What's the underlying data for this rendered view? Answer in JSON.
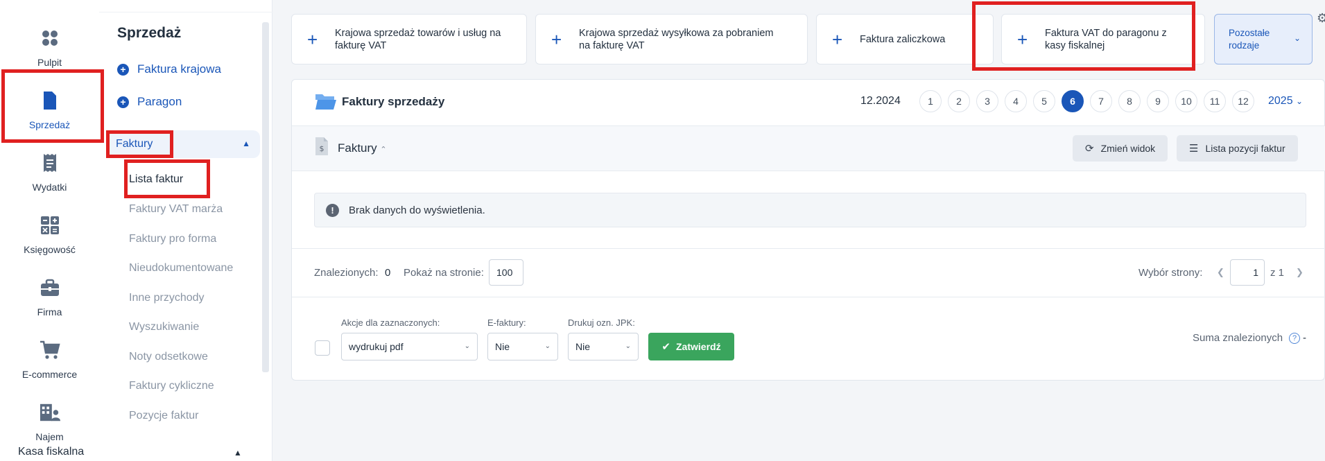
{
  "rail": [
    {
      "label": "Pulpit",
      "icon": "dashboard-icon"
    },
    {
      "label": "Sprzedaż",
      "icon": "invoice-dollar-icon"
    },
    {
      "label": "Wydatki",
      "icon": "receipt-icon"
    },
    {
      "label": "Księgowość",
      "icon": "calculator-icon"
    },
    {
      "label": "Firma",
      "icon": "briefcase-icon"
    },
    {
      "label": "E-commerce",
      "icon": "cart-icon"
    },
    {
      "label": "Najem",
      "icon": "building-person-icon"
    }
  ],
  "sidebar": {
    "title": "Sprzedaż",
    "actions": [
      "Faktura krajowa",
      "Paragon"
    ],
    "group": "Faktury",
    "items": [
      "Lista faktur",
      "Faktury VAT marża",
      "Faktury pro forma",
      "Nieudokumentowane",
      "Inne przychody",
      "Wyszukiwanie",
      "Noty odsetkowe",
      "Faktury cykliczne",
      "Pozycje faktur"
    ],
    "group2": "Kasa fiskalna"
  },
  "quick": [
    {
      "line1": "Krajowa sprzedaż towarów i usług na",
      "line2": "fakturę VAT"
    },
    {
      "line1": "Krajowa sprzedaż wysyłkowa za pobraniem",
      "line2": "na fakturę VAT"
    },
    {
      "line1": "Faktura zaliczkowa",
      "line2": ""
    },
    {
      "line1": "Faktura VAT do paragonu z",
      "line2": "kasy fiskalnej"
    }
  ],
  "quick_other": {
    "line1": "Pozostałe",
    "line2": "rodzaje"
  },
  "panel": {
    "title": "Faktury sprzedaży",
    "period": "12.2024",
    "months": [
      "1",
      "2",
      "3",
      "4",
      "5",
      "6",
      "7",
      "8",
      "9",
      "10",
      "11",
      "12"
    ],
    "active_month": "6",
    "year": "2025",
    "sub_title": "Faktury",
    "btn_view": "Zmień widok",
    "btn_list": "Lista pozycji faktur",
    "empty": "Brak danych do wyświetlenia.",
    "found_label": "Znalezionych:",
    "found_value": "0",
    "per_page_label": "Pokaż na stronie:",
    "per_page_value": "100",
    "page_label": "Wybór strony:",
    "page_value": "1",
    "page_of": "z 1",
    "actions_label": "Akcje dla zaznaczonych:",
    "actions_value": "wydrukuj pdf",
    "efak_label": "E-faktury:",
    "efak_value": "Nie",
    "jpk_label": "Drukuj ozn. JPK:",
    "jpk_value": "Nie",
    "confirm": "Zatwierdź",
    "sum_label": "Suma znalezionych",
    "sum_value": "-"
  },
  "colors": {
    "accent": "#1a56b8",
    "highlight": "#e02020",
    "confirm": "#3aa55d"
  }
}
